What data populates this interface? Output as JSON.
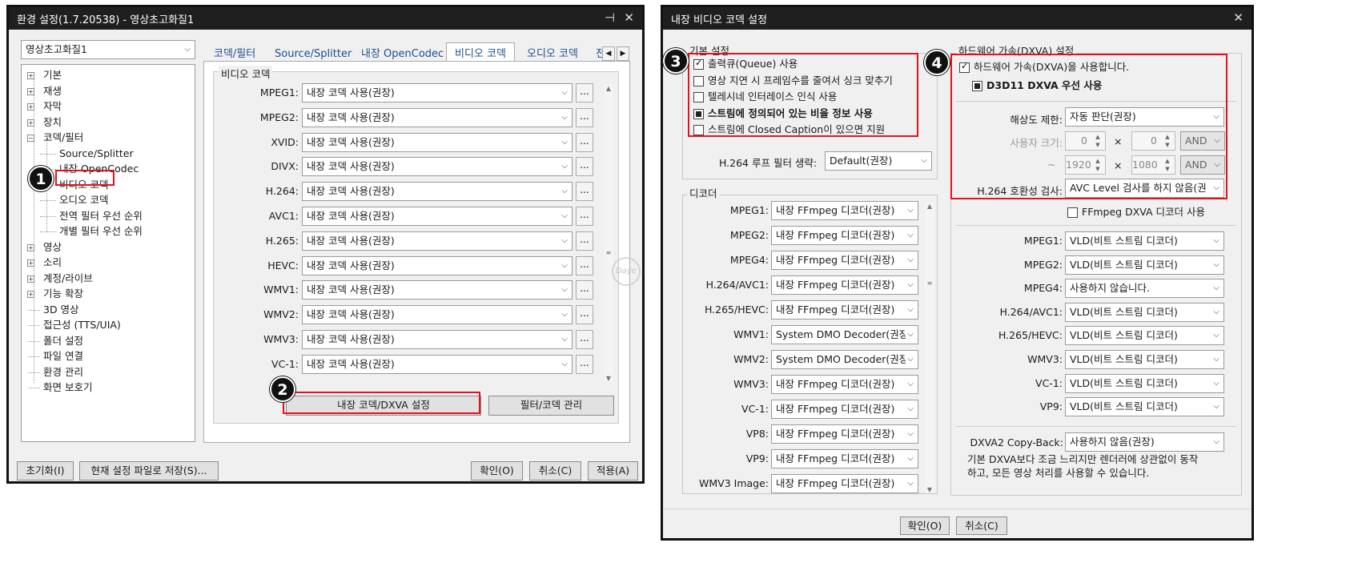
{
  "left": {
    "title": "환경 설정(1.7.20538) - 영상초고화질1",
    "profile_combo": "영상초고화질1",
    "tree": [
      "기본",
      "재생",
      "자막",
      "장치",
      "코덱/필터",
      "Source/Splitter",
      "내장 OpenCodec",
      "비디오 코덱",
      "오디오 코덱",
      "전역 필터 우선 순위",
      "개별 필터 우선 순위",
      "영상",
      "소리",
      "계정/라이브",
      "기능 확장",
      "3D 영상",
      "접근성 (TTS/UIA)",
      "폴더 설정",
      "파일 연결",
      "환경 관리",
      "화면 보호기"
    ],
    "tabs": [
      "코덱/필터",
      "Source/Splitter",
      "내장 OpenCodec",
      "비디오 코덱",
      "오디오 코덱",
      "전"
    ],
    "group_title": "비디오 코덱",
    "codecs": [
      {
        "label": "MPEG1:",
        "value": "내장 코덱 사용(권장)"
      },
      {
        "label": "MPEG2:",
        "value": "내장 코덱 사용(권장)"
      },
      {
        "label": "XVID:",
        "value": "내장 코덱 사용(권장)"
      },
      {
        "label": "DIVX:",
        "value": "내장 코덱 사용(권장)"
      },
      {
        "label": "H.264:",
        "value": "내장 코덱 사용(권장)"
      },
      {
        "label": "AVC1:",
        "value": "내장 코덱 사용(권장)"
      },
      {
        "label": "H.265:",
        "value": "내장 코덱 사용(권장)"
      },
      {
        "label": "HEVC:",
        "value": "내장 코덱 사용(권장)"
      },
      {
        "label": "WMV1:",
        "value": "내장 코덱 사용(권장)"
      },
      {
        "label": "WMV2:",
        "value": "내장 코덱 사용(권장)"
      },
      {
        "label": "WMV3:",
        "value": "내장 코덱 사용(권장)"
      },
      {
        "label": "VC-1:",
        "value": "내장 코덱 사용(권장)"
      }
    ],
    "more_btn": "...",
    "codec_dxva_btn": "내장 코덱/DXVA 설정",
    "filter_btn": "필터/코덱 관리",
    "reset_btn": "초기화(I)",
    "save_btn": "현재 설정 파일로 저장(S)...",
    "ok_btn": "확인(O)",
    "cancel_btn": "취소(C)",
    "apply_btn": "적용(A)",
    "watermark": "Daye"
  },
  "right": {
    "title": "내장 비디오 코덱 설정",
    "basic_title": "기본 설정",
    "basic": [
      {
        "label": "출력큐(Queue) 사용",
        "state": "checked"
      },
      {
        "label": "영상 지연 시 프레임수를 줄여서 싱크 맞추기",
        "state": "off"
      },
      {
        "label": "텔레시네 인터레이스 인식 사용",
        "state": "off"
      },
      {
        "label": "스트림에 정의되어 있는 비율 정보 사용",
        "state": "indeterminate"
      },
      {
        "label": "스트림에 Closed Caption이 있으면 지원",
        "state": "off"
      }
    ],
    "loop_label": "H.264 루프 필터 생략:",
    "loop_value": "Default(권장)",
    "decoder_title": "디코더",
    "decoders": [
      {
        "label": "MPEG1:",
        "value": "내장 FFmpeg 디코더(권장)"
      },
      {
        "label": "MPEG2:",
        "value": "내장 FFmpeg 디코더(권장)"
      },
      {
        "label": "MPEG4:",
        "value": "내장 FFmpeg 디코더(권장)"
      },
      {
        "label": "H.264/AVC1:",
        "value": "내장 FFmpeg 디코더(권장)"
      },
      {
        "label": "H.265/HEVC:",
        "value": "내장 FFmpeg 디코더(권장)"
      },
      {
        "label": "WMV1:",
        "value": "System DMO Decoder(권장"
      },
      {
        "label": "WMV2:",
        "value": "System DMO Decoder(권장"
      },
      {
        "label": "WMV3:",
        "value": "내장 FFmpeg 디코더(권장)"
      },
      {
        "label": "VC-1:",
        "value": "내장 FFmpeg 디코더(권장)"
      },
      {
        "label": "VP8:",
        "value": "내장 FFmpeg 디코더(권장)"
      },
      {
        "label": "VP9:",
        "value": "내장 FFmpeg 디코더(권장)"
      },
      {
        "label": "WMV3 Image:",
        "value": "내장 FFmpeg 디코더(권장)"
      }
    ],
    "hw_title": "하드웨어 가속(DXVA) 설정",
    "hw_enable": "하드웨어 가속(DXVA)을 사용합니다.",
    "d3d11": "D3D11 DXVA 우선 사용",
    "res_label": "해상도 제한:",
    "res_value": "자동 판단(권장)",
    "user_size_label": "사용자 크기:",
    "user_w": "0",
    "user_h": "0",
    "and1": "AND",
    "max_w": "1920",
    "max_h": "1080",
    "and2": "AND",
    "tilde": "~",
    "times": "×",
    "h264_check_label": "H.264 호환성 검사:",
    "h264_check_value": "AVC Level 검사를 하지 않음(권",
    "ffmpeg_dxva": "FFmpeg DXVA 디코더 사용",
    "hw_decoders": [
      {
        "label": "MPEG1:",
        "value": "VLD(비트 스트림 디코더)"
      },
      {
        "label": "MPEG2:",
        "value": "VLD(비트 스트림 디코더)"
      },
      {
        "label": "MPEG4:",
        "value": "사용하지 않습니다."
      },
      {
        "label": "H.264/AVC1:",
        "value": "VLD(비트 스트림 디코더)"
      },
      {
        "label": "H.265/HEVC:",
        "value": "VLD(비트 스트림 디코더)"
      },
      {
        "label": "WMV3:",
        "value": "VLD(비트 스트림 디코더)"
      },
      {
        "label": "VC-1:",
        "value": "VLD(비트 스트림 디코더)"
      },
      {
        "label": "VP9:",
        "value": "VLD(비트 스트림 디코더)"
      }
    ],
    "copyback_label": "DXVA2 Copy-Back:",
    "copyback_value": "사용하지 않음(권장)",
    "copyback_desc1": "기본 DXVA보다 조금 느리지만 렌더러에 상관없이 동작",
    "copyback_desc2": "하고, 모든 영상 처리를 사용할 수 있습니다.",
    "ok_btn": "확인(O)",
    "cancel_btn": "취소(C)"
  },
  "badges": [
    "1",
    "2",
    "3",
    "4"
  ],
  "colors": {
    "annotation_red": "#e0141e",
    "titlebar": "#1f1f1f",
    "link_blue": "#1b4f8f"
  }
}
